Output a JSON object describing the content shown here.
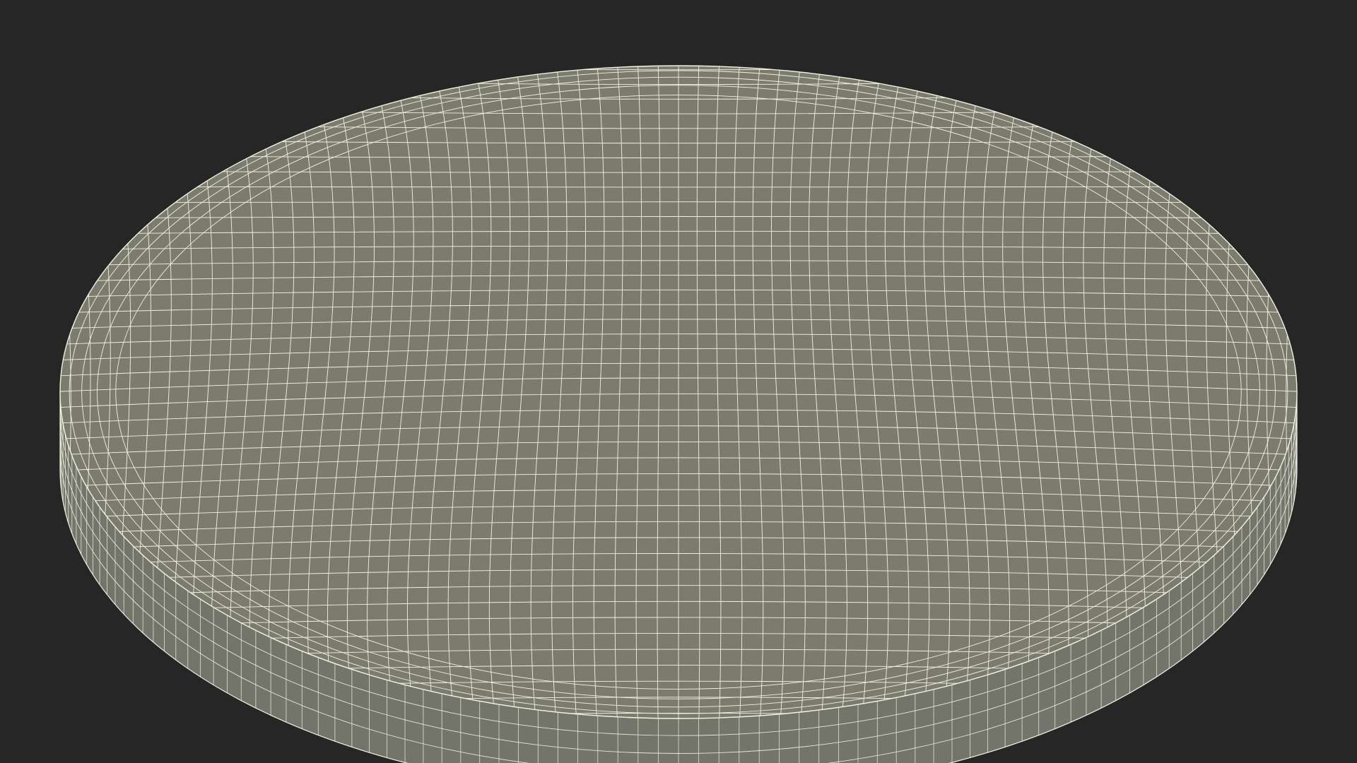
{
  "scene": {
    "subject": "wireframe-disc-mesh",
    "colors": {
      "background": "#262626",
      "mesh_fill_top": "#7b7c6e",
      "mesh_fill_side": "#74756a",
      "wire": "#f2f2e4"
    }
  }
}
